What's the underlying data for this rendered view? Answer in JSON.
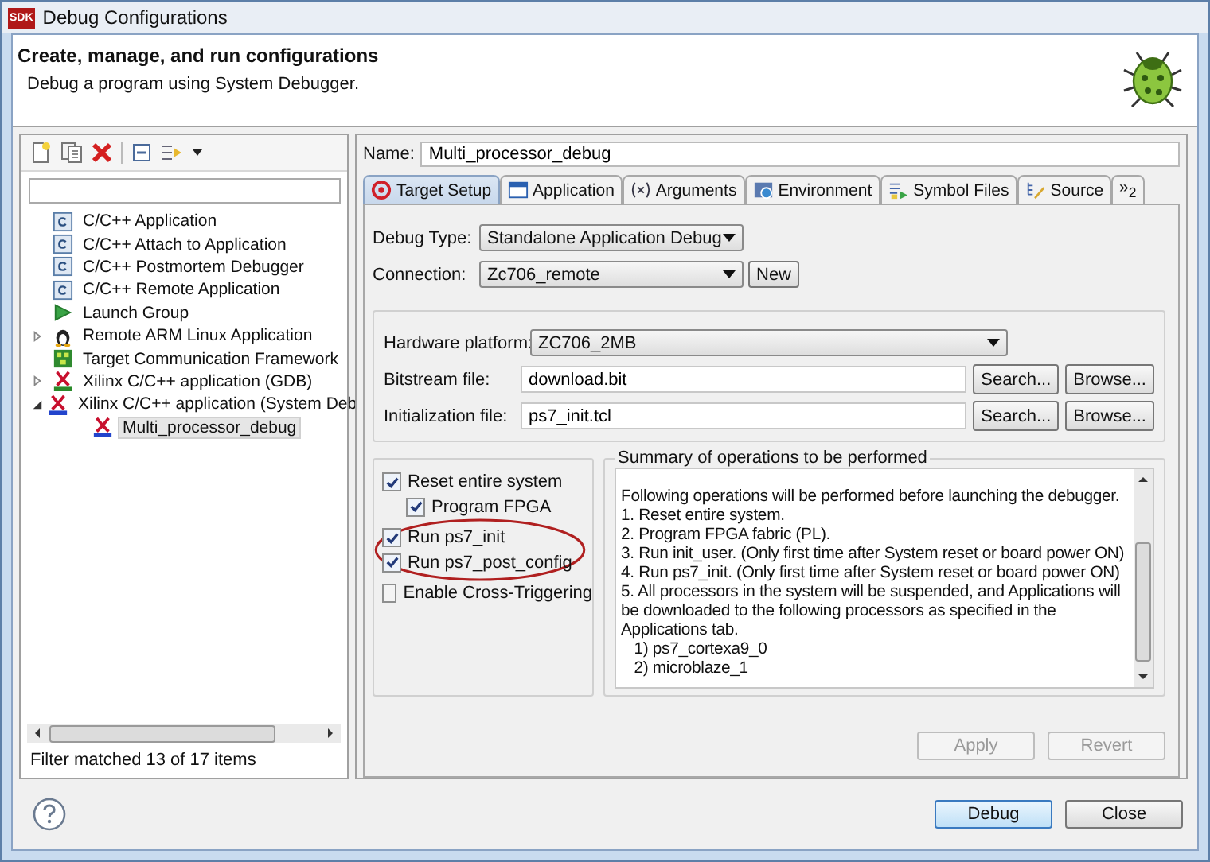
{
  "window": {
    "title": "Debug Configurations",
    "app_icon": "SDK"
  },
  "header": {
    "title": "Create, manage, and run configurations",
    "subtitle": "Debug a program using System Debugger."
  },
  "sidebar": {
    "items": [
      {
        "label": "C/C++ Application",
        "kind": "c-app",
        "selected": false
      },
      {
        "label": "C/C++ Attach to Application",
        "kind": "c-app",
        "selected": false
      },
      {
        "label": "C/C++ Postmortem Debugger",
        "kind": "c-app",
        "selected": false
      },
      {
        "label": "C/C++ Remote Application",
        "kind": "c-app",
        "selected": false
      },
      {
        "label": "Launch Group",
        "kind": "launch",
        "selected": false
      },
      {
        "label": "Remote ARM Linux Application",
        "kind": "linux",
        "selected": false,
        "expanded": false
      },
      {
        "label": "Target Communication Framework",
        "kind": "tcf",
        "selected": false
      },
      {
        "label": "Xilinx C/C++ application (GDB)",
        "kind": "xilinx-gdb",
        "selected": false,
        "expanded": false
      },
      {
        "label": "Xilinx C/C++ application (System Deb",
        "kind": "xilinx-tcf",
        "selected": false,
        "expanded": true,
        "children": [
          {
            "label": "Multi_processor_debug",
            "kind": "xilinx-tcf",
            "selected": true
          }
        ]
      }
    ],
    "status": "Filter matched 13 of 17 items"
  },
  "config": {
    "name_label": "Name:",
    "name": "Multi_processor_debug",
    "tabs": [
      {
        "label": "Target Setup",
        "kind": "target",
        "selected": true
      },
      {
        "label": "Application",
        "kind": "app",
        "selected": false
      },
      {
        "label": "Arguments",
        "kind": "args",
        "selected": false
      },
      {
        "label": "Environment",
        "kind": "env",
        "selected": false
      },
      {
        "label": "Symbol Files",
        "kind": "symbols",
        "selected": false
      },
      {
        "label": "Source",
        "kind": "source",
        "selected": false
      },
      {
        "label": "»$_{2}$",
        "kind": "more",
        "selected": false
      }
    ],
    "debug_type": {
      "label": "Debug Type:",
      "value": "Standalone Application Debug"
    },
    "connection": {
      "label": "Connection:",
      "value": "Zc706_remote",
      "button": "New"
    },
    "hardware_platform": {
      "label": "Hardware platform:",
      "value": "ZC706_2MB"
    },
    "files": [
      {
        "label": "Bitstream file:",
        "value": "download.bit",
        "search": "Search...",
        "browse": "Browse..."
      },
      {
        "label": "Initialization file:",
        "value": "ps7_init.tcl",
        "search": "Search...",
        "browse": "Browse..."
      }
    ],
    "options": [
      {
        "label": "Reset entire system",
        "checked": true,
        "children": [
          {
            "label": "Program FPGA",
            "checked": true
          }
        ]
      },
      {
        "label": "Run ps7_init",
        "checked": true,
        "highlighted": true
      },
      {
        "label": "Run ps7_post_config",
        "checked": true,
        "highlighted": true
      },
      {
        "label": "Enable Cross-Triggering",
        "checked": false,
        "highlighted": false
      }
    ],
    "summary": {
      "title": "Summary of operations to be performed",
      "lines": [
        "Following operations will be performed before launching the debugger.",
        "1. Reset entire system.",
        "2. Program FPGA fabric (PL).",
        "3. Run init_user. (Only first time after System reset or board power ON)",
        "4. Run ps7_init. (Only first time after System reset or board power ON)",
        "5. All processors in the system will be suspended, and Applications will be downloaded to the following processors as specified in the Applications tab.",
        "   1) ps7_cortexa9_0",
        "   2) microblaze_1"
      ]
    },
    "apply": {
      "label": "Apply",
      "disabled": true
    },
    "revert": {
      "label": "Revert",
      "disabled": true
    }
  },
  "footer": {
    "buttons": [
      {
        "label": "Debug",
        "default": true
      },
      {
        "label": "Close",
        "default": false
      }
    ]
  }
}
